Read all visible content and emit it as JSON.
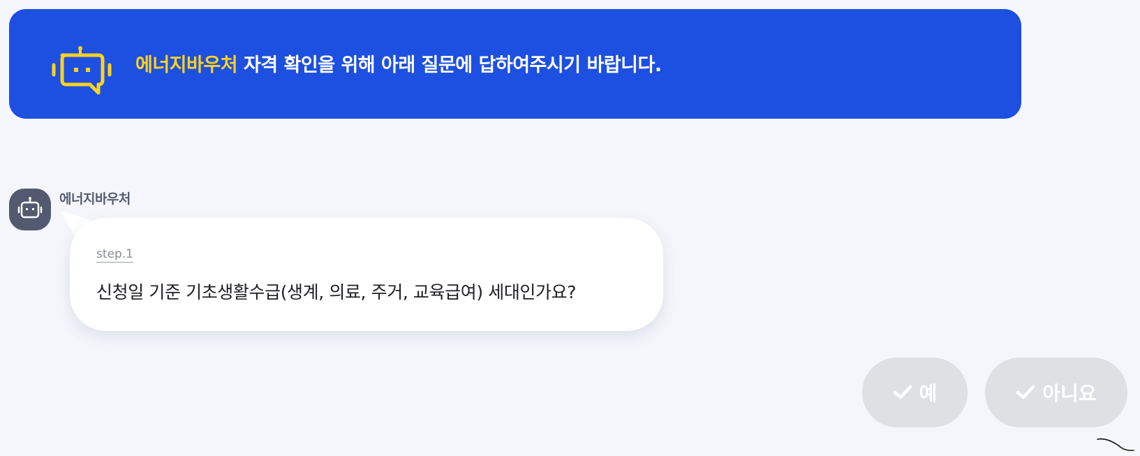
{
  "banner": {
    "highlight": "에너지바우처",
    "message": " 자격 확인을 위해 아래 질문에 답하여주시기 바랍니다.",
    "icon": "chatbot-icon",
    "background_color": "#1d4fe0",
    "highlight_color": "#ffd21f"
  },
  "chat": {
    "sender_name": "에너지바우처",
    "avatar_icon": "robot-icon",
    "step_label": "step.1",
    "question": "신청일 기준 기초생활수급(생계, 의료, 주거, 교육급여) 세대인가요?"
  },
  "answers": {
    "yes_label": "예",
    "no_label": "아니요",
    "check_icon": "check-icon",
    "button_color": "#dfe0e4"
  }
}
